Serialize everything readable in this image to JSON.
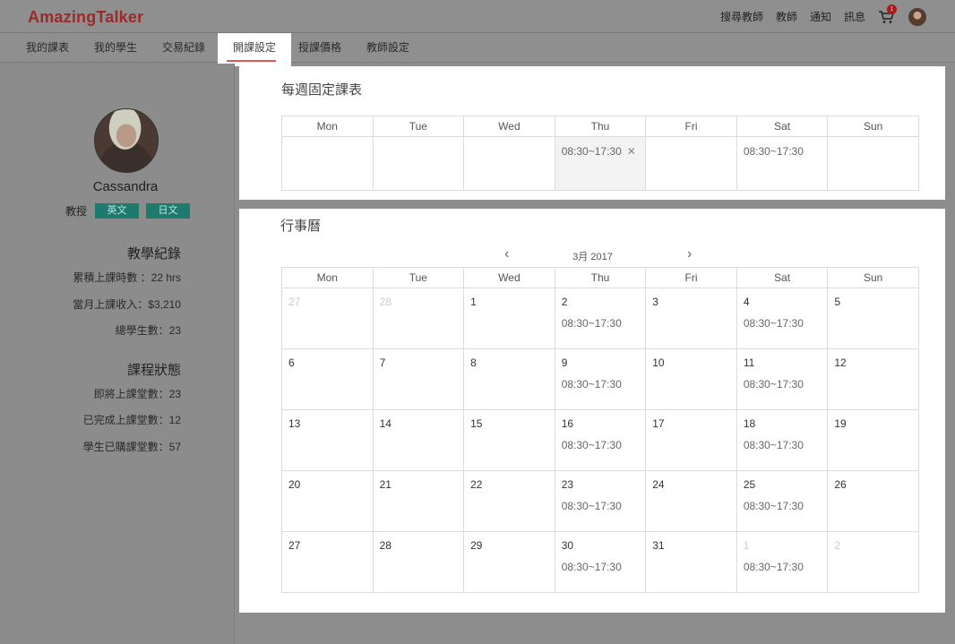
{
  "app": {
    "logo": "AmazingTalker"
  },
  "topnav": {
    "items": [
      "搜尋教師",
      "教師",
      "通知",
      "訊息"
    ],
    "cart_count": "1"
  },
  "subnav": {
    "tabs": [
      "我的課表",
      "我的學生",
      "交易紀錄",
      "開課設定",
      "授課價格",
      "教師設定"
    ],
    "active": "開課設定"
  },
  "profile": {
    "name": "Cassandra",
    "teach_label": "教授",
    "languages": [
      "英文",
      "日文"
    ],
    "teaching_record_title": "教學紀錄",
    "teaching_stats": [
      "累積上課時數 ：22 hrs",
      "當月上課收入：$3,210",
      "總學生數：23"
    ],
    "course_status_title": "課程狀態",
    "course_stats": [
      "即將上課堂數：23",
      "已完成上課堂數：12",
      "學生已購課堂數：57"
    ]
  },
  "weekly": {
    "title": "每週固定課表",
    "days": [
      "Mon",
      "Tue",
      "Wed",
      "Thu",
      "Fri",
      "Sat",
      "Sun"
    ],
    "slots": [
      "",
      "",
      "",
      "08:30~17:30",
      "",
      "08:30~17:30",
      ""
    ]
  },
  "calendar": {
    "title": "行事曆",
    "month_label": "3月   2017",
    "days": [
      "Mon",
      "Tue",
      "Wed",
      "Thu",
      "Fri",
      "Sat",
      "Sun"
    ],
    "weeks": [
      [
        {
          "d": "27",
          "muted": true
        },
        {
          "d": "28",
          "muted": true
        },
        {
          "d": "1"
        },
        {
          "d": "2",
          "slot": "08:30~17:30"
        },
        {
          "d": "3"
        },
        {
          "d": "4",
          "slot": "08:30~17:30"
        },
        {
          "d": "5"
        }
      ],
      [
        {
          "d": "6"
        },
        {
          "d": "7"
        },
        {
          "d": "8"
        },
        {
          "d": "9",
          "slot": "08:30~17:30"
        },
        {
          "d": "10"
        },
        {
          "d": "11",
          "slot": "08:30~17:30"
        },
        {
          "d": "12"
        }
      ],
      [
        {
          "d": "13"
        },
        {
          "d": "14"
        },
        {
          "d": "15"
        },
        {
          "d": "16",
          "slot": "08:30~17:30"
        },
        {
          "d": "17"
        },
        {
          "d": "18",
          "slot": "08:30~17:30"
        },
        {
          "d": "19"
        }
      ],
      [
        {
          "d": "20"
        },
        {
          "d": "21"
        },
        {
          "d": "22"
        },
        {
          "d": "23",
          "slot": "08:30~17:30"
        },
        {
          "d": "24"
        },
        {
          "d": "25",
          "slot": "08:30~17:30"
        },
        {
          "d": "26"
        }
      ],
      [
        {
          "d": "27"
        },
        {
          "d": "28"
        },
        {
          "d": "29"
        },
        {
          "d": "30",
          "slot": "08:30~17:30"
        },
        {
          "d": "31"
        },
        {
          "d": "1",
          "muted": true,
          "slot": "08:30~17:30"
        },
        {
          "d": "2",
          "muted": true
        }
      ]
    ]
  },
  "colors": {
    "logo": "#9b2a2a",
    "badge_teal": "#1d7a6e",
    "tab_underline": "#e05858"
  }
}
